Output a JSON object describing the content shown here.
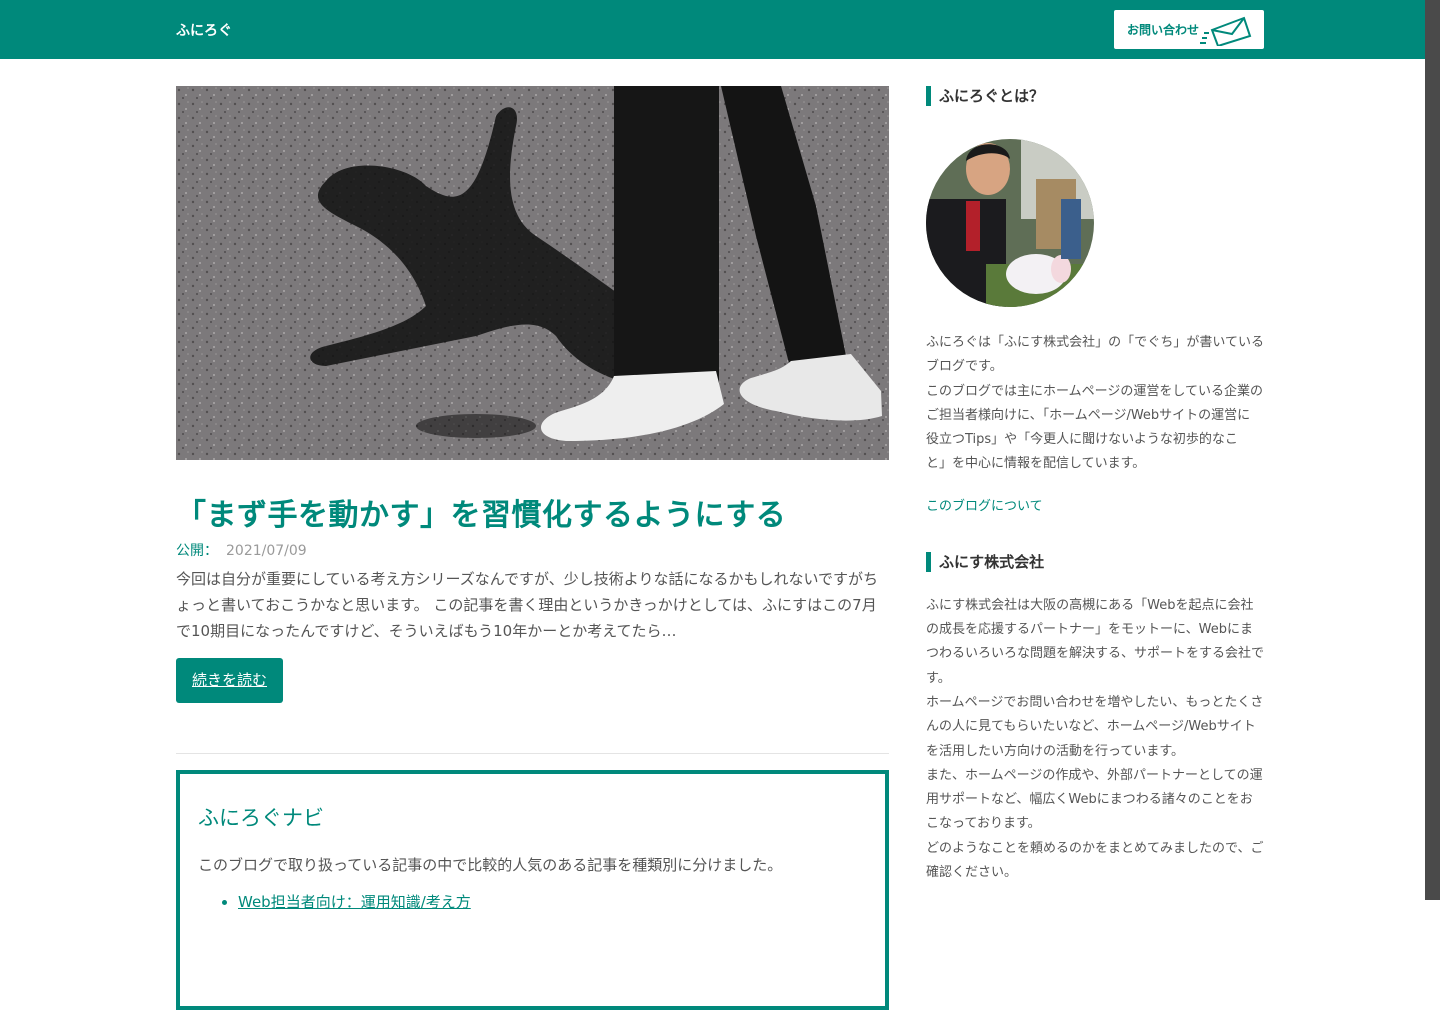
{
  "header": {
    "site_title": "ふにろぐ",
    "contact_label": "お問い合わせ"
  },
  "post": {
    "title": "「まず手を動かす」を習慣化するようにする",
    "date_label": "公開：",
    "date": "2021/07/09",
    "excerpt": "今回は自分が重要にしている考え方シリーズなんですが、少し技術よりな話になるかもしれないですがちょっと書いておこうかなと思います。 この記事を書く理由というかきっかけとしては、ふにすはこの7月で10期目になったんですけど、そういえばもう10年かーとか考えてたら…",
    "read_more": "続きを読む"
  },
  "navi": {
    "title": "ふにろぐナビ",
    "description": "このブログで取り扱っている記事の中で比較的人気のある記事を種類別に分けました。",
    "items": [
      "Web担当者向け：運用知識/考え方"
    ]
  },
  "sidebar": {
    "about_title": "ふにろぐとは？",
    "about_lines": [
      "ふにろぐは「ふにす株式会社」の「でぐち」が書いている",
      "ブログです。",
      "このブログでは主にホームページの運営をしている企業の",
      "ご担当者様向けに、「ホームページ/Webサイトの運営に",
      "役立つTips」や「今更人に聞けないような初歩的なこ",
      "と」を中心に情報を配信しています。"
    ],
    "about_link": "このブログについて",
    "company_title": "ふにす株式会社",
    "company_lines": [
      "ふにす株式会社は大阪の高槻にある「Webを起点に会社",
      "の成長を応援するパートナー」をモットーに、Webにま",
      "つわるいろいろな問題を解決する、サポートをする会社で",
      "す。",
      "ホームページでお問い合わせを増やしたい、もっとたくさ",
      "んの人に見てもらいたいなど、ホームページ/Webサイト",
      "を活用したい方向けの活動を行っています。",
      "また、ホームページの作成や、外部パートナーとしての運",
      "用サポートなど、幅広くWebにまつわる諸々のことをお",
      "こなっております。",
      "どのようなことを頼めるのかをまとめてみましたので、ご",
      "確認ください。"
    ]
  },
  "colors": {
    "accent": "#00897b",
    "text": "#555555",
    "muted": "#9a9a9a"
  }
}
